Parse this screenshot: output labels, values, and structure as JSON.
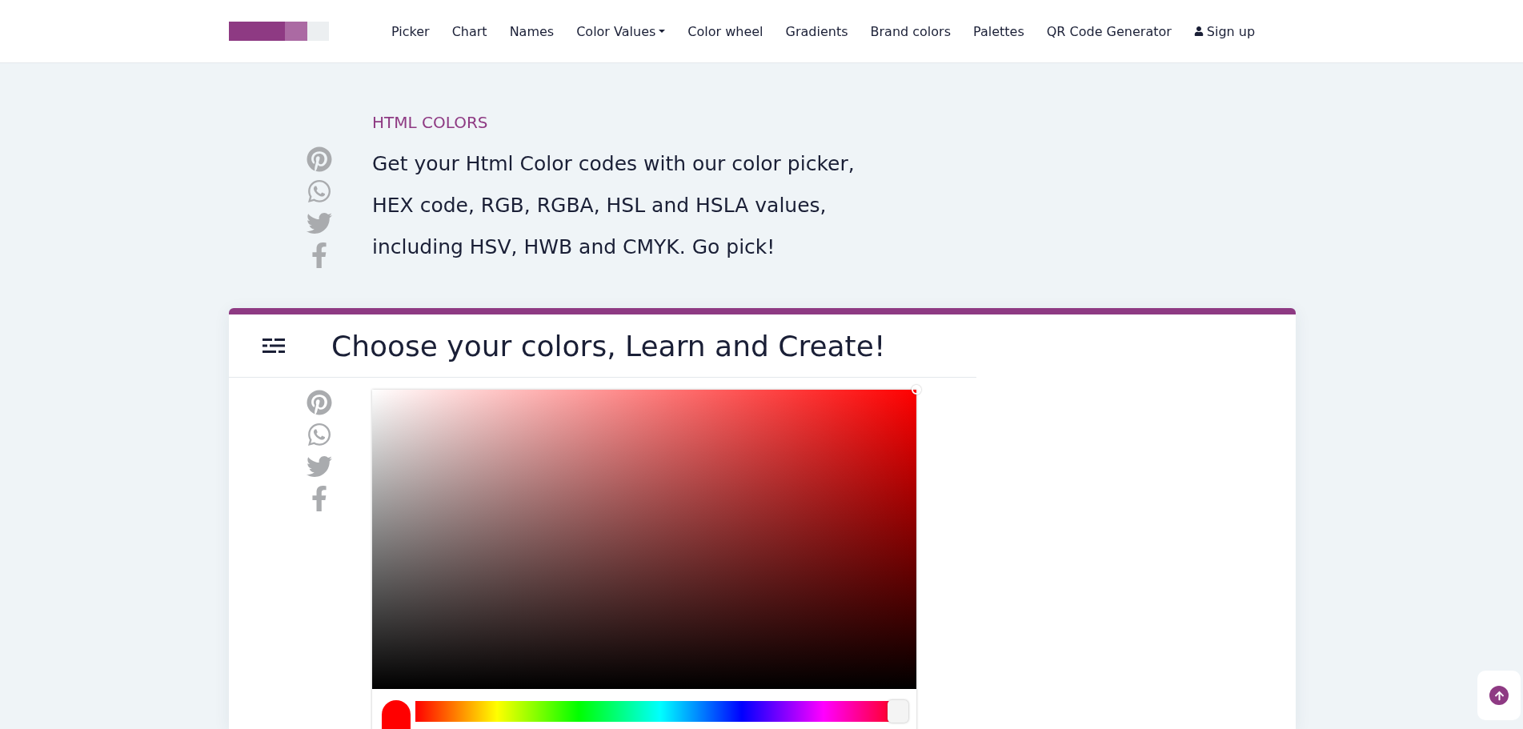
{
  "logo": {
    "swatches": [
      {
        "color": "#8e3a83"
      },
      {
        "color": "#ab6aa3"
      },
      {
        "color": "#eceff1"
      }
    ]
  },
  "nav": [
    {
      "label": "Picker",
      "kind": "link"
    },
    {
      "label": "Chart",
      "kind": "link"
    },
    {
      "label": "Names",
      "kind": "link"
    },
    {
      "label": "Color Values",
      "kind": "dropdown"
    },
    {
      "label": "Color wheel",
      "kind": "link"
    },
    {
      "label": "Gradients",
      "kind": "link"
    },
    {
      "label": "Brand colors",
      "kind": "link"
    },
    {
      "label": "Palettes",
      "kind": "link"
    },
    {
      "label": "QR Code Generator",
      "kind": "link"
    },
    {
      "label": "Sign up",
      "kind": "account"
    }
  ],
  "hero": {
    "eyebrow": "HTML COLORS",
    "lines": [
      "Get your Html Color codes with our color picker,",
      "HEX code, RGB, RGBA, HSL and HSLA values,",
      "including HSV, HWB and CMYK. Go pick!"
    ],
    "share": [
      {
        "kind": "pinterest"
      },
      {
        "kind": "whatsapp"
      },
      {
        "kind": "twitter"
      },
      {
        "kind": "facebook"
      }
    ]
  },
  "card": {
    "title": "Choose your colors, Learn and Create!",
    "share": [
      {
        "kind": "pinterest"
      },
      {
        "kind": "whatsapp"
      },
      {
        "kind": "twitter"
      },
      {
        "kind": "facebook"
      }
    ],
    "picker": {
      "hue": {
        "level": 1
      }
    }
  }
}
